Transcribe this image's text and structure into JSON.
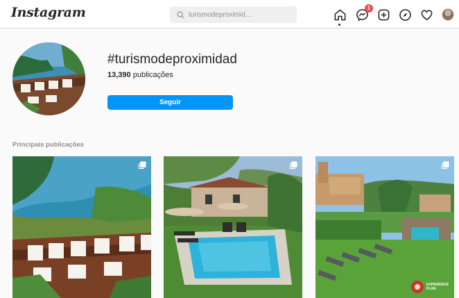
{
  "nav": {
    "logo": "Instagram",
    "search_placeholder": "turismodeproximid...",
    "messages_badge": "1",
    "icons": [
      "search-icon",
      "home-icon",
      "messenger-icon",
      "new-post-icon",
      "explore-icon",
      "heart-icon",
      "profile-avatar"
    ]
  },
  "profile": {
    "hashtag": "#turismodeproximidad",
    "posts_number": "13,390",
    "posts_label": "publicações",
    "follow_button": "Seguir"
  },
  "sections": {
    "top_posts": "Principais publicações"
  },
  "posts": [
    {
      "description_icon": "multiple-photos-icon"
    },
    {
      "description_icon": "multiple-photos-icon"
    },
    {
      "description_icon": "multiple-photos-icon",
      "watermark": "EXPERIENCE PLAN"
    }
  ],
  "colors": {
    "accent": "#0095f6",
    "badge": "#ed4956",
    "text": "#262626",
    "muted": "#8e8e8e",
    "background": "#fafafa"
  }
}
